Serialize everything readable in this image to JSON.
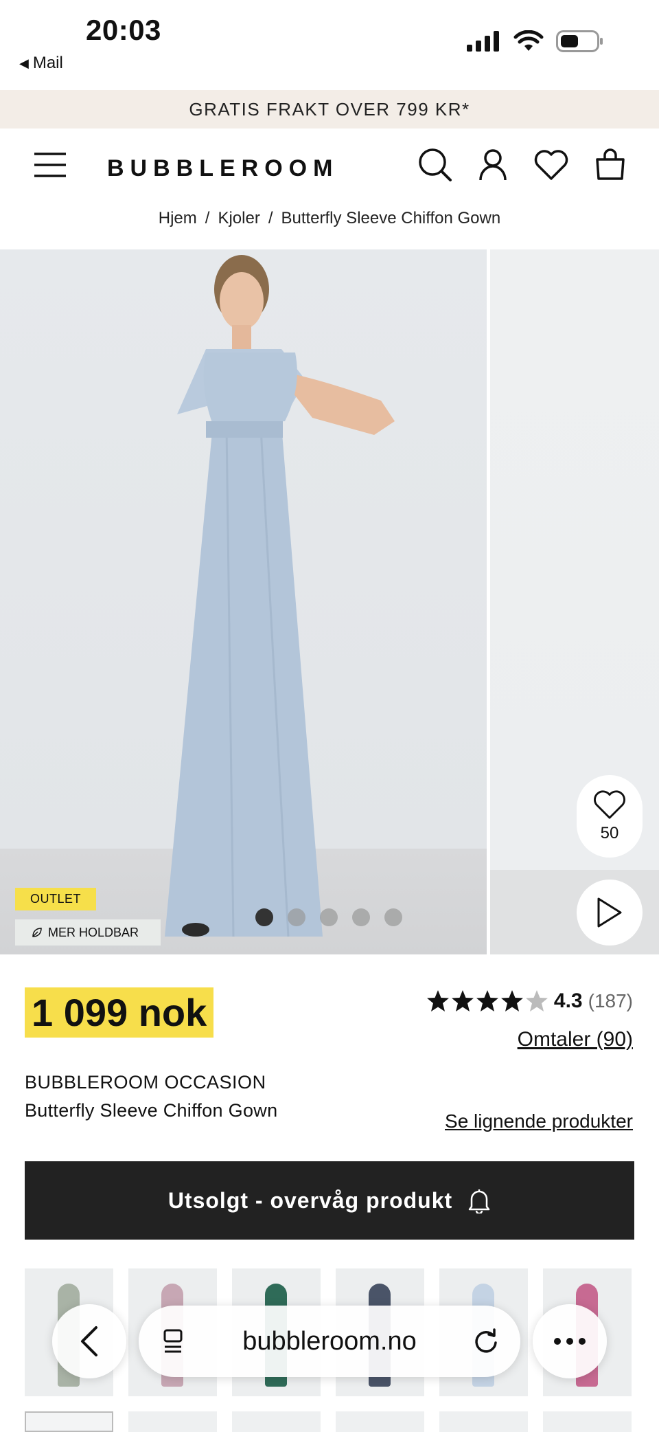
{
  "status_bar": {
    "time": "20:03",
    "back_app": "Mail"
  },
  "promo": {
    "text": "GRATIS FRAKT OVER 799 KR*"
  },
  "header": {
    "logo": "BUBBLEROOM",
    "icons": [
      "menu-icon",
      "search-icon",
      "account-icon",
      "heart-icon",
      "bag-icon"
    ]
  },
  "breadcrumb": {
    "items": [
      "Hjem",
      "Kjoler",
      "Butterfly Sleeve Chiffon Gown"
    ],
    "separator": "/"
  },
  "gallery": {
    "favorite_count": "50",
    "badges": {
      "outlet": "OUTLET",
      "sustainable": "MER HOLDBAR"
    },
    "dots_total": 5,
    "dots_active": 1
  },
  "product": {
    "price": "1 099 nok",
    "rating": {
      "stars": 4.3,
      "score": "4.3",
      "count": "(187)"
    },
    "reviews_link": "Omtaler (90)",
    "brand": "BUBBLEROOM OCCASION",
    "name": "Butterfly Sleeve Chiffon Gown",
    "similar_link": "Se lignende produkter",
    "cta": "Utsolgt - overvåg produkt"
  },
  "colors": {
    "accent_yellow": "#f7de4b",
    "cta_dark": "#222222",
    "promo_bg": "#f3ede7",
    "dress_blue": "#b7c9dc"
  },
  "variants": {
    "colors": [
      "#a9b3a6",
      "#c7a7b4",
      "#2f6b58",
      "#4a5468",
      "#c4d3e4",
      "#c76a92"
    ]
  },
  "safari": {
    "url": "bubbleroom.no"
  }
}
